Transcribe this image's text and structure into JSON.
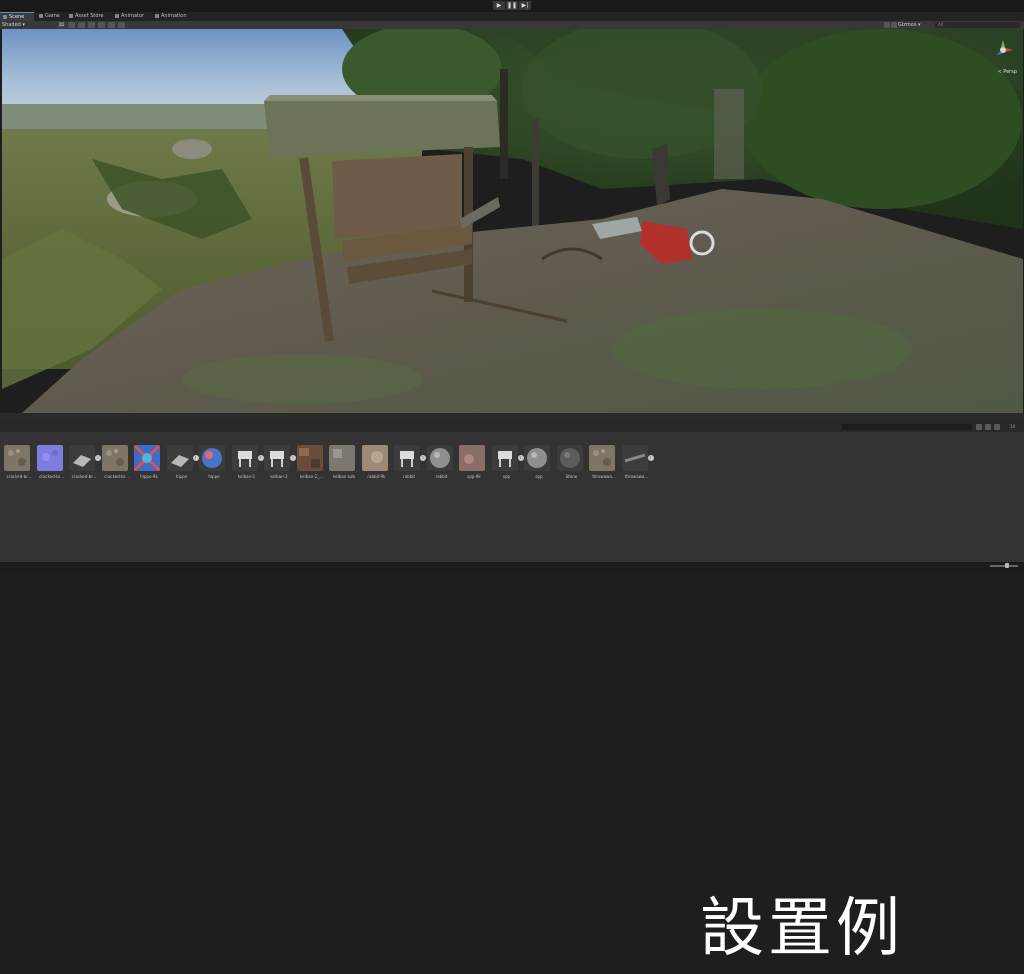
{
  "play_controls": {
    "play": "▶",
    "pause": "❚❚",
    "step": "▶|"
  },
  "tabs": [
    {
      "label": "Scene",
      "icon": "grid-icon"
    },
    {
      "label": "Game",
      "icon": "gamepad-icon"
    },
    {
      "label": "Asset Store",
      "icon": "store-icon"
    },
    {
      "label": "Animator",
      "icon": "animator-icon"
    },
    {
      "label": "Animation",
      "icon": "clock-icon"
    }
  ],
  "scene_toolbar": {
    "draw_mode": "Shaded",
    "mode_2d": "2D",
    "gizmos": "Gizmos",
    "search_placeholder": "All"
  },
  "viewport": {
    "projection": "< Persp"
  },
  "project": {
    "search_placeholder": "",
    "item_count": "14",
    "assets": [
      {
        "label": "cracked-br...",
        "thumb": "rock",
        "expandable": false
      },
      {
        "label": "cracked-br...",
        "thumb": "normal",
        "expandable": false
      },
      {
        "label": "cracked-br...",
        "thumb": "model-grey",
        "expandable": true
      },
      {
        "label": "cracked-br...",
        "thumb": "rock",
        "expandable": false
      },
      {
        "label": "hippo-9k",
        "thumb": "normal-map",
        "expandable": false
      },
      {
        "label": "hippo",
        "thumb": "model-grey",
        "expandable": true
      },
      {
        "label": "hippo",
        "thumb": "sphere-blue",
        "expandable": false
      },
      {
        "label": "keiban-1",
        "thumb": "model-white",
        "expandable": true
      },
      {
        "label": "keiban-2",
        "thumb": "model-white",
        "expandable": true
      },
      {
        "label": "keiban-2_...",
        "thumb": "texture-color",
        "expandable": false
      },
      {
        "label": "keiban-sub",
        "thumb": "texture-grey",
        "expandable": false
      },
      {
        "label": "rabbit-9k",
        "thumb": "texture-tan",
        "expandable": false
      },
      {
        "label": "rabbit",
        "thumb": "model-white",
        "expandable": true
      },
      {
        "label": "rabbit",
        "thumb": "sphere-grey",
        "expandable": false
      },
      {
        "label": "spp-9k",
        "thumb": "texture-pink",
        "expandable": false
      },
      {
        "label": "spp",
        "thumb": "model-white",
        "expandable": true
      },
      {
        "label": "spp",
        "thumb": "sphere-grey",
        "expandable": false
      },
      {
        "label": "Stone",
        "thumb": "sphere-dark",
        "expandable": false
      },
      {
        "label": "throwawa...",
        "thumb": "rock",
        "expandable": false
      },
      {
        "label": "throwawa...",
        "thumb": "model-dark",
        "expandable": true
      }
    ]
  },
  "caption": "設置例",
  "colors": {
    "accent": "#4a8cd8",
    "panel": "#333333",
    "background": "#1e1e1e"
  }
}
